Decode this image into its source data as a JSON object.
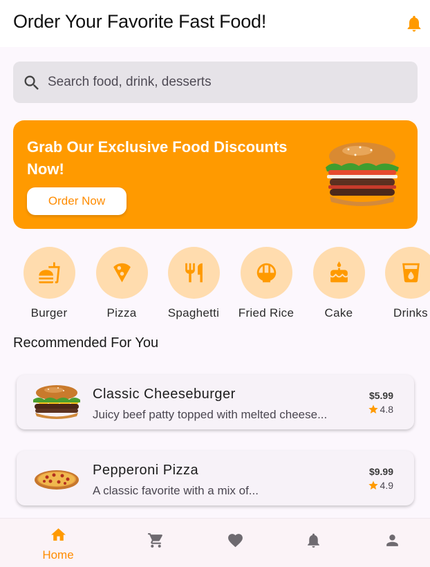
{
  "header": {
    "title": "Order Your Favorite Fast Food!",
    "notification_icon": "bell-icon"
  },
  "search": {
    "placeholder": "Search food, drink, desserts",
    "value": ""
  },
  "banner": {
    "title": "Grab Our Exclusive Food Discounts Now!",
    "button_label": "Order Now",
    "image": "burger-image"
  },
  "categories": [
    {
      "label": "Burger",
      "icon": "burger-icon"
    },
    {
      "label": "Pizza",
      "icon": "pizza-icon"
    },
    {
      "label": "Spaghetti",
      "icon": "utensils-icon"
    },
    {
      "label": "Fried Rice",
      "icon": "rice-bowl-icon"
    },
    {
      "label": "Cake",
      "icon": "cake-icon"
    },
    {
      "label": "Drinks",
      "icon": "drink-icon"
    }
  ],
  "recommended": {
    "title": "Recommended For You",
    "items": [
      {
        "name": "Classic Cheeseburger",
        "description": "Juicy beef patty topped with melted cheese...",
        "price": "$5.99",
        "rating": "4.8"
      },
      {
        "name": "Pepperoni Pizza",
        "description": "A classic favorite with a mix of...",
        "price": "$9.99",
        "rating": "4.9"
      }
    ]
  },
  "bottom_nav": {
    "items": [
      {
        "label": "Home",
        "icon": "home-icon",
        "active": true
      },
      {
        "label": "",
        "icon": "cart-icon",
        "active": false
      },
      {
        "label": "",
        "icon": "heart-icon",
        "active": false
      },
      {
        "label": "",
        "icon": "bell-icon",
        "active": false
      },
      {
        "label": "",
        "icon": "person-icon",
        "active": false
      }
    ]
  },
  "colors": {
    "accent": "#ff9a00",
    "category_bg": "#ffdcae",
    "nav_inactive": "#6e6a70",
    "star": "#ff9a00"
  }
}
